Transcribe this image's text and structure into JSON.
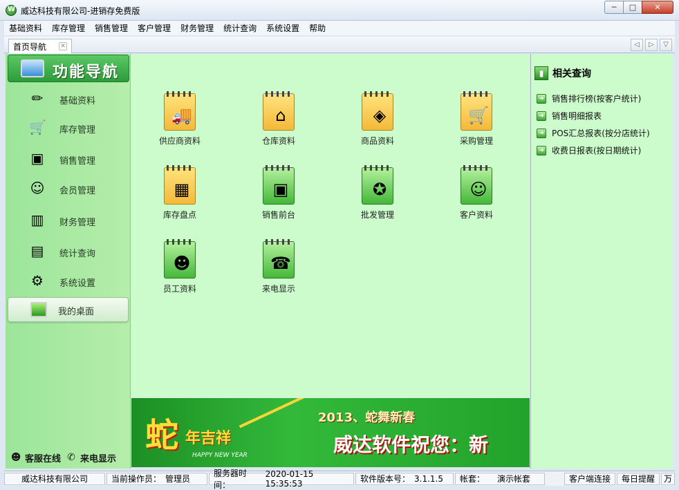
{
  "window": {
    "title": "威达科技有限公司-进销存免费版"
  },
  "menu": [
    "基础资料",
    "库存管理",
    "销售管理",
    "客户管理",
    "财务管理",
    "统计查询",
    "系统设置",
    "帮助"
  ],
  "tabs": [
    {
      "label": "首页导航"
    }
  ],
  "left_nav": {
    "header": "功能导航",
    "items": [
      {
        "label": "基础资料",
        "icon": "pencil-icon"
      },
      {
        "label": "库存管理",
        "icon": "cart-icon"
      },
      {
        "label": "销售管理",
        "icon": "register-icon"
      },
      {
        "label": "会员管理",
        "icon": "members-icon"
      },
      {
        "label": "财务管理",
        "icon": "chart-icon"
      },
      {
        "label": "统计查询",
        "icon": "stats-icon"
      },
      {
        "label": "系统设置",
        "icon": "gears-icon"
      }
    ],
    "desktop": "我的桌面",
    "bottom": {
      "service": "客服在线",
      "caller": "来电显示"
    }
  },
  "tiles": [
    {
      "label": "供应商资料",
      "icon": "truck-icon",
      "color": "yellow"
    },
    {
      "label": "仓库资料",
      "icon": "house-icon",
      "color": "yellow"
    },
    {
      "label": "商品资料",
      "icon": "products-icon",
      "color": "yellow"
    },
    {
      "label": "采购管理",
      "icon": "cart-download-icon",
      "color": "yellow"
    },
    {
      "label": "库存盘点",
      "icon": "calculator-icon",
      "color": "yellow"
    },
    {
      "label": "销售前台",
      "icon": "cash-register-icon",
      "color": "green"
    },
    {
      "label": "批发管理",
      "icon": "sale-tag-icon",
      "color": "green"
    },
    {
      "label": "客户资料",
      "icon": "customers-icon",
      "color": "green"
    },
    {
      "label": "员工资料",
      "icon": "employee-icon",
      "color": "green"
    },
    {
      "label": "来电显示",
      "icon": "phone-icon",
      "color": "green"
    }
  ],
  "banner": {
    "big_char": "蛇",
    "blessing": "年吉祥",
    "headline": "2013、蛇舞新春",
    "message": "威达软件祝您：新",
    "small_text": "HAPPY NEW YEAR"
  },
  "right_panel": {
    "title": "相关查询",
    "links": [
      "销售排行榜(按客户统计)",
      "销售明细报表",
      "POS汇总报表(按分店统计)",
      "收费日报表(按日期统计)"
    ]
  },
  "status": {
    "company": "威达科技有限公司",
    "operator_label": "当前操作员：",
    "operator": "管理员",
    "server_time_label": "服务器时间：",
    "server_time": "2020-01-15 15:35:53",
    "version_label": "软件版本号：",
    "version": "3.1.1.5",
    "account_label": "帐套：",
    "account": "演示帐套",
    "connection": "客户端连接",
    "reminder": "每日提醒",
    "extra": "万"
  }
}
